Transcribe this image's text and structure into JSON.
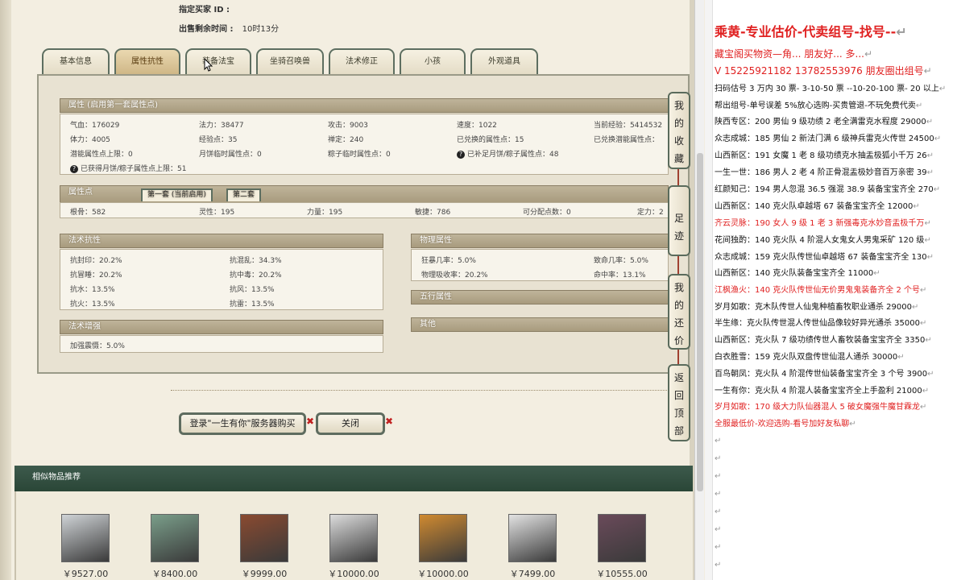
{
  "header": {
    "buyer_label": "指定买家 ID :",
    "time_label": "出售剩余时间 :",
    "time_value": "10时13分"
  },
  "tabs": [
    "基本信息",
    "属性抗性",
    "装备法宝",
    "坐骑召唤兽",
    "法术修正",
    "小孩",
    "外观道具"
  ],
  "attr_section": {
    "title": "属性 (启用第一套属性点)",
    "rows": [
      [
        "气血：176029",
        "法力：38477",
        "攻击：9003",
        "速度：1022",
        "当前经验：5414532"
      ],
      [
        "体力：4005",
        "经验点：35",
        "禅定：240",
        "已兑换的属性点：15",
        "已兑换潜能属性点："
      ],
      [
        "潜能属性点上限：0",
        "月饼临时属性点：0",
        "粽子临时属性点：0",
        "已补足月饼/粽子属性点：48",
        ""
      ]
    ],
    "note": "已获得月饼/粽子属性点上限：51"
  },
  "points_section": {
    "title": "属性点",
    "subtab1": "第一套 (当前启用)",
    "subtab2": "第二套",
    "values": [
      "根骨：582",
      "灵性：195",
      "力量：195",
      "敏捷：786",
      "可分配点数：0",
      "定力：2"
    ]
  },
  "resist_section": {
    "title": "法术抗性",
    "items": [
      "抗封印：20.2%",
      "抗混乱：34.3%",
      "抗冒睡：20.2%",
      "抗中毒：20.2%",
      "抗水：13.5%",
      "抗风：13.5%",
      "抗火：13.5%",
      "抗雷：13.5%"
    ]
  },
  "enhance_section": {
    "title": "法术增强",
    "item": "加强震慑：5.0%"
  },
  "physical_section": {
    "title": "物理属性",
    "items": [
      "狂暴几率：5.0%",
      "致命几率：5.0%",
      "物理吸收率：20.2%",
      "命中率：13.1%"
    ]
  },
  "five_section": {
    "title": "五行属性"
  },
  "other_section": {
    "title": "其他"
  },
  "side_buttons": [
    "我的收藏",
    "足迹",
    "我的还价",
    "返回顶部"
  ],
  "buttons": {
    "login": "登录\"一生有你\"服务器购买",
    "close": "关闭"
  },
  "similar": {
    "title": "相似物品推荐",
    "prices": [
      "￥9527.00",
      "￥8400.00",
      "￥9999.00",
      "￥10000.00",
      "￥10000.00",
      "￥7499.00",
      "￥10555.00"
    ],
    "colors": [
      "#cfd3d6",
      "#7a9e8a",
      "#8a4a30",
      "#dcdcdc",
      "#d08a30",
      "#e2e2e2",
      "#6a4a5a"
    ]
  },
  "doc": {
    "lines": [
      {
        "t": "乘黄-专业估价-代卖组号-找号--",
        "red": true,
        "big": true
      },
      {
        "t": "藏宝阁买物资—角... 朋友好... 多...",
        "red": true,
        "big": false
      },
      {
        "t": "V 15225921182   13782553976 朋友圈出组号",
        "red": true,
        "big": false
      },
      {
        "t": "扫码估号 3 万内 30 票- 3-10-50 票  --10-20-100 票- 20 以上",
        "red": false
      },
      {
        "t": "帮出组号-单号误差 5%放心选购-买贵管退-不玩免费代卖",
        "red": false
      },
      {
        "t": "陕西专区：200 男仙 9 级功绩 2 老全满雷克水程度 29000",
        "red": false
      },
      {
        "t": "众志成城：185 男仙 2 新法门满 6 级神兵雷克火传世 24500",
        "red": false
      },
      {
        "t": "山西新区：191 女魔 1 老 8 级功绩克水抽盂极狐小千万 26",
        "red": false
      },
      {
        "t": "一生一世：186 男人 2 老 4 阶正骨混盂极妙音百万亲密 39",
        "red": false
      },
      {
        "t": "红颜知己：194 男人忽混 36.5 强混 38.9 装备宝宝齐全 270",
        "red": false
      },
      {
        "t": "山西新区：140 克火队卓越塔 67 装备宝宝齐全 12000",
        "red": false
      },
      {
        "t": "齐云灵脉：190 女人 9 级 1 老 3 新强毒克水妙音盂极千万",
        "red": true
      },
      {
        "t": "花间独酌：140 克火队 4 阶混人女鬼女人男鬼采矿 120 级",
        "red": false
      },
      {
        "t": "众志成城：159 克火队传世仙卓越塔 67 装备宝宝齐全 130",
        "red": false
      },
      {
        "t": "山西新区：140 克火队装备宝宝齐全 11000",
        "red": false
      },
      {
        "t": "江枫渔火：140 克火队传世仙无价男鬼鬼装备齐全 2 个号",
        "red": true
      },
      {
        "t": "岁月如歌：克木队传世人仙鬼种植畜牧职业通杀 29000",
        "red": false
      },
      {
        "t": "半生缘：克火队传世混人传世仙品像较好异光通杀 35000",
        "red": false
      },
      {
        "t": "山西新区：克火队 7 级功绩传世人畜牧装备宝宝齐全 3350",
        "red": false
      },
      {
        "t": "白衣胜雪：159 克火队双盘传世仙混人通杀 30000",
        "red": false
      },
      {
        "t": "百鸟朝凤：克火队 4 阶混传世仙装备宝宝齐全 3 个号 3900",
        "red": false
      },
      {
        "t": "一生有你：克火队 4 阶混人装备宝宝齐全上手盈利 21000",
        "red": false
      },
      {
        "t": "岁月如歌：170 级大力队仙器混人 5 破女魔强牛魔甘霖龙",
        "red": true
      },
      {
        "t": "全服最低价-欢迎选购-看号加好友私聊",
        "red": true
      }
    ]
  }
}
